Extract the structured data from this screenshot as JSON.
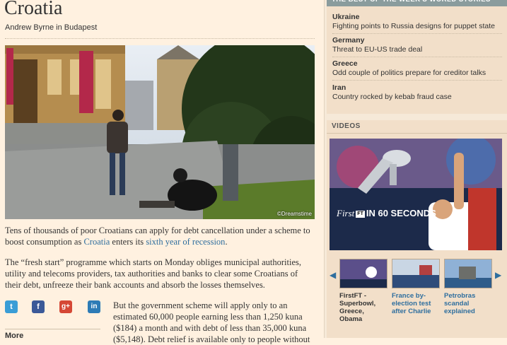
{
  "article": {
    "headline": "Croatia",
    "byline": "Andrew Byrne in Budapest",
    "photo_credit": "©Dreamstime",
    "p1_before": "Tens of thousands of poor Croatians can apply for debt cancellation under a scheme to boost consumption as ",
    "p1_link1": "Croatia",
    "p1_middle": " enters its ",
    "p1_link2": "sixth year of recession",
    "p1_after": ".",
    "p2": "The “fresh start” programme which starts on Monday obliges municipal authorities, utility and telecoms providers, tax authorities and banks to clear some Croatians of their debt, unfreeze their bank accounts and absorb the losses themselves.",
    "p3": "But the government scheme will apply only to an estimated 60,000 people earning less than 1,250 kuna ($184) a month and with debt of less than 35,000 kuna ($5,148). Debt relief is available only to people without",
    "more_label": "More"
  },
  "social": {
    "twitter": "t",
    "facebook": "f",
    "googleplus": "g+",
    "linkedin": "in"
  },
  "world_stories": {
    "header": "THE BEST OF THE WEEK'S WORLD STORIES",
    "items": [
      {
        "country": "Ukraine",
        "title": "Fighting points to Russia designs for puppet state"
      },
      {
        "country": "Germany",
        "title": "Threat to EU-US trade deal"
      },
      {
        "country": "Greece",
        "title": "Odd couple of politics prepare for creditor talks"
      },
      {
        "country": "Iran",
        "title": "Country rocked by kebab fraud case"
      }
    ]
  },
  "videos": {
    "header": "VIDEOS",
    "player_title_first": "First",
    "player_title_ft": "FT",
    "player_title_rest": "IN 60 SECONDS",
    "thumbs": [
      {
        "caption": "FirstFT - Superbowl, Greece, Obama"
      },
      {
        "caption": "France by-election test after Charlie"
      },
      {
        "caption": "Petrobras scandal explained"
      }
    ]
  },
  "colors": {
    "page_bg": "#fff1e0",
    "link": "#2e6e9e",
    "sidebar_header": "#8a9c9d"
  }
}
